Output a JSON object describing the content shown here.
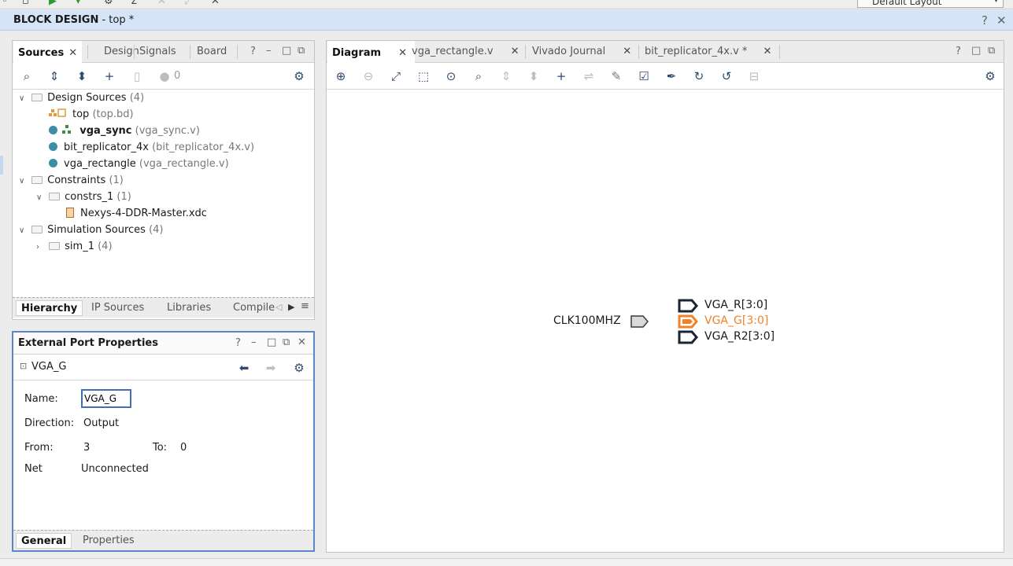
{
  "header": {
    "title_bold": "BLOCK DESIGN",
    "title_rest": " - top *",
    "help": "?",
    "close": "✕"
  },
  "layout_select": "Default Layout",
  "sources": {
    "tabs": [
      "Sources",
      "Design",
      "Signals",
      "Board"
    ],
    "close": "✕",
    "count": "0",
    "tree": {
      "design_sources": {
        "label": "Design Sources",
        "count": "(4)"
      },
      "top": {
        "name": "top",
        "file": "(top.bd)"
      },
      "vga_sync": {
        "name": "vga_sync",
        "file": "(vga_sync.v)"
      },
      "bit_rep": {
        "name": "bit_replicator_4x",
        "file": "(bit_replicator_4x.v)"
      },
      "vga_rect": {
        "name": "vga_rectangle",
        "file": "(vga_rectangle.v)"
      },
      "constraints": {
        "label": "Constraints",
        "count": "(1)"
      },
      "constrs": {
        "label": "constrs_1",
        "count": "(1)"
      },
      "xdc": {
        "name": "Nexys-4-DDR-Master.xdc"
      },
      "sim": {
        "label": "Simulation Sources",
        "count": "(4)"
      },
      "sim1": {
        "label": "sim_1",
        "count": "(4)"
      }
    },
    "bottom_tabs": [
      "Hierarchy",
      "IP Sources",
      "Libraries",
      "Compile"
    ]
  },
  "props": {
    "title": "External Port Properties",
    "object": "VGA_G",
    "name_label": "Name:",
    "name_value": "VGA_G",
    "direction_label": "Direction:",
    "direction_value": "Output",
    "from_label": "From:",
    "from_value": "3",
    "to_label": "To:",
    "to_value": "0",
    "net_label": "Net",
    "net_value": "Unconnected",
    "bottom_tabs": [
      "General",
      "Properties"
    ]
  },
  "diagram": {
    "tabs": [
      "Diagram",
      "vga_rectangle.v",
      "Vivado Journal",
      "bit_replicator_4x.v *"
    ],
    "close": "✕",
    "ports": {
      "clk": "CLK100MHZ",
      "r": "VGA_R[3:0]",
      "g": "VGA_G[3:0]",
      "r2": "VGA_R2[3:0]"
    },
    "colors": {
      "selected": "#f0822a",
      "port_border": "#1b2433"
    }
  }
}
